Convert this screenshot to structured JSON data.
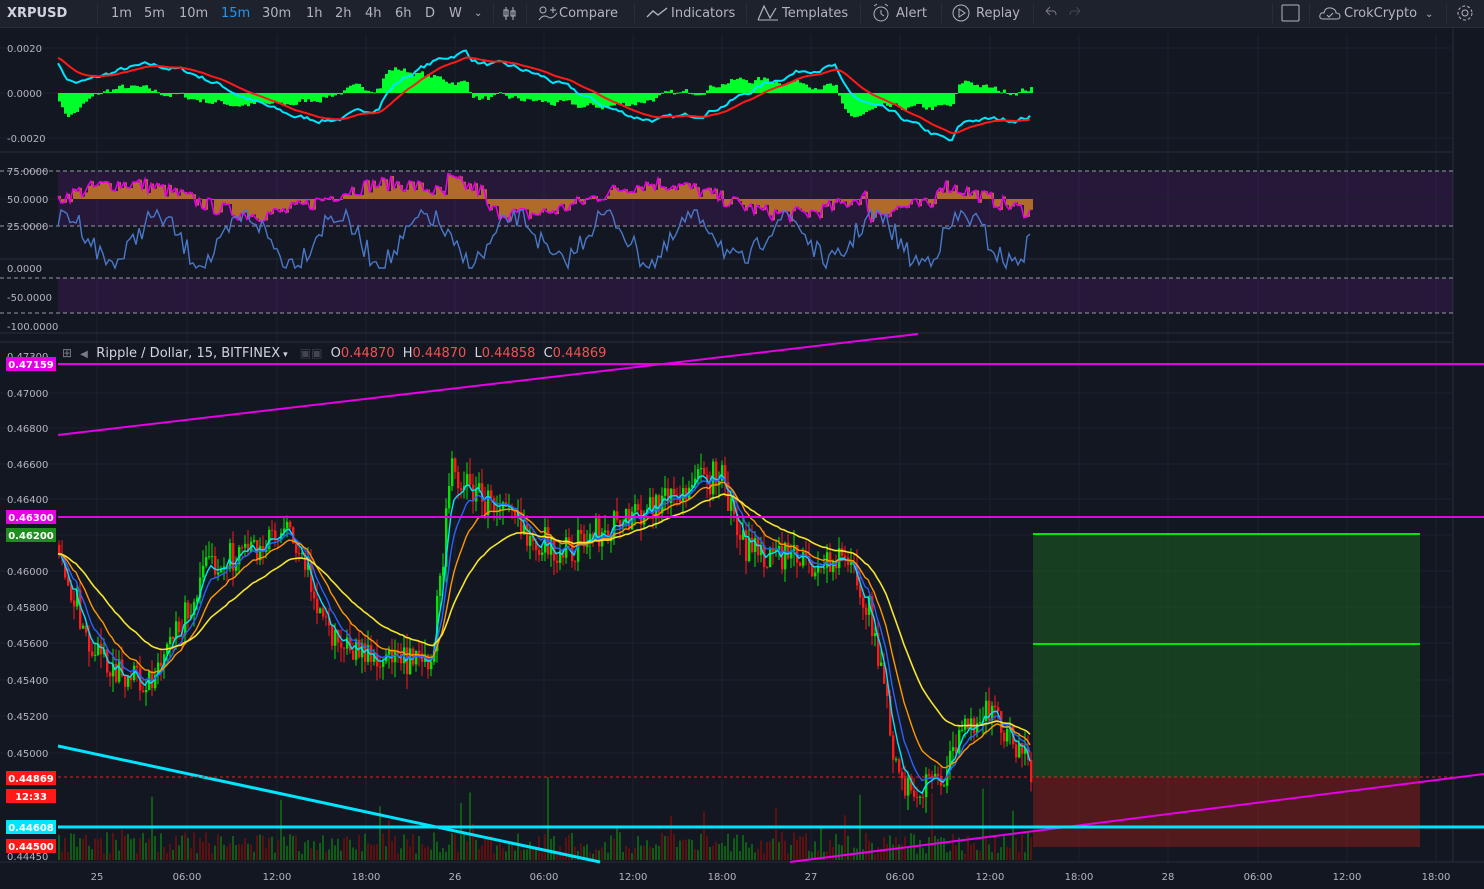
{
  "toolbar": {
    "symbol": "XRPUSD",
    "intervals": [
      "1m",
      "5m",
      "10m",
      "15m",
      "30m",
      "1h",
      "2h",
      "4h",
      "6h",
      "D",
      "W"
    ],
    "active_interval": "15m",
    "compare": "Compare",
    "indicators": "Indicators",
    "templates": "Templates",
    "alert": "Alert",
    "replay": "Replay",
    "user": "CrokCrypto"
  },
  "legend": {
    "title": "Ripple / Dollar, 15, BITFINEX",
    "open_key": "O",
    "open": "0.44870",
    "high_key": "H",
    "high": "0.44870",
    "low_key": "L",
    "low": "0.44858",
    "close_key": "C",
    "close": "0.44869"
  },
  "colors": {
    "bg": "#131722",
    "up": "#00e600",
    "down": "#ff1a1a",
    "magenta": "#e600e6",
    "cyan": "#00e5ff",
    "yellow": "#f5e52b",
    "orange": "#ff9800",
    "blue": "#2962ff",
    "indicator_blue": "#4a78c8",
    "brown": "#b06a2a"
  },
  "panes": {
    "macd_ticks": [
      "0.0020",
      "0.0000",
      "-0.0020"
    ],
    "rsi_ticks": [
      "75.0000",
      "50.0000",
      "25.0000"
    ],
    "willr_ticks": [
      "0.0000",
      "-50.0000",
      "-100.0000"
    ]
  },
  "price_axis": {
    "ticks": [
      "0.47300",
      "0.47000",
      "0.46800",
      "0.46600",
      "0.46400",
      "0.46200",
      "0.46000",
      "0.45800",
      "0.45600",
      "0.45400",
      "0.45200",
      "0.45000",
      "0.44450"
    ],
    "tags": [
      {
        "value": "0.47159",
        "color": "#e600e6"
      },
      {
        "value": "0.46300",
        "color": "#e600e6"
      },
      {
        "value": "0.46200",
        "color": "#1e8e1e"
      },
      {
        "value": "0.44869",
        "color": "#ff1a1a"
      },
      {
        "value": "12:33",
        "color": "#ff1a1a"
      },
      {
        "value": "0.44608",
        "color": "#00e5ff"
      },
      {
        "value": "0.44500",
        "color": "#ff1a1a"
      }
    ]
  },
  "time_axis": [
    "25",
    "06:00",
    "12:00",
    "18:00",
    "26",
    "06:00",
    "12:00",
    "18:00",
    "27",
    "06:00",
    "12:00",
    "18:00",
    "28",
    "06:00",
    "12:00",
    "18:00"
  ]
}
